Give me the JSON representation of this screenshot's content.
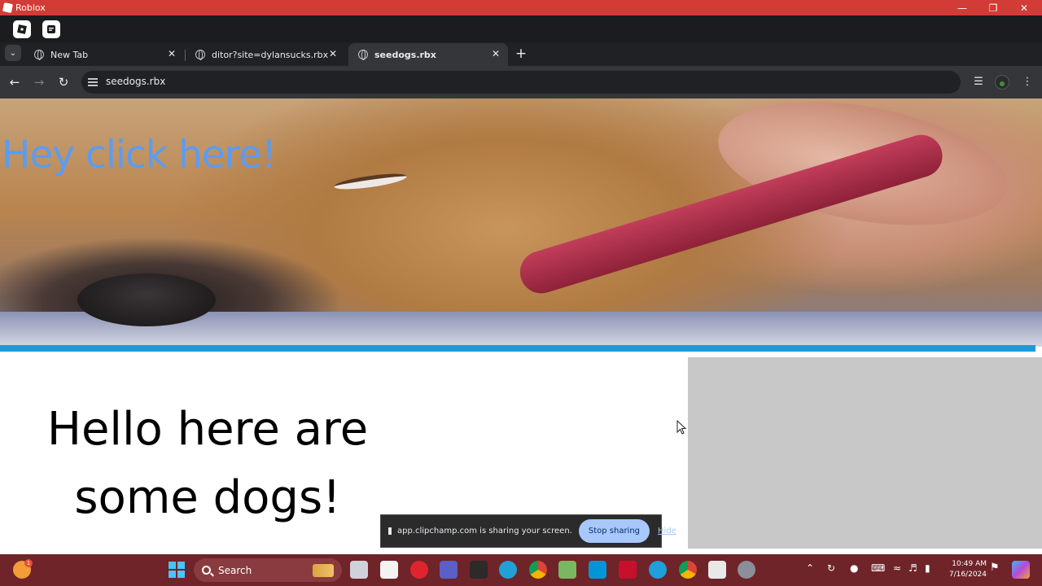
{
  "window": {
    "title": "Roblox"
  },
  "tabs": [
    {
      "label": "New Tab"
    },
    {
      "label": "ditor?site=dylansucks.rbx"
    },
    {
      "label": "seedogs.rbx"
    }
  ],
  "omnibox": {
    "url": "seedogs.rbx"
  },
  "page": {
    "hero_link": "Hey click here!",
    "heading_line1": "Hello here are",
    "heading_line2": "some dogs!"
  },
  "share_bar": {
    "message": "app.clipchamp.com is sharing your screen.",
    "stop_label": "Stop sharing",
    "hide_label": "Hide"
  },
  "taskbar": {
    "search_label": "Search",
    "notification_count": "1",
    "time": "10:49 AM",
    "date": "7/16/2024"
  },
  "colors": {
    "titlebar": "#d33b36",
    "hero_link": "#5b9cf2",
    "rule": "#1e9bd7",
    "taskbar": "#6e2428"
  }
}
